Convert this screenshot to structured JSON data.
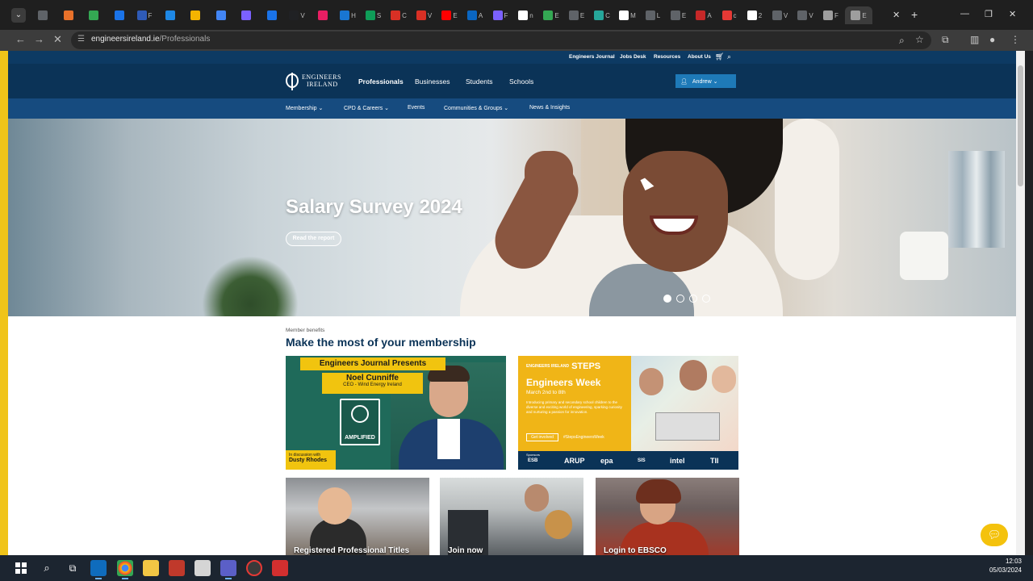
{
  "browser": {
    "url_domain": "engineersireland.ie",
    "url_path": "/Professionals",
    "tabs": [
      {
        "label": "",
        "color": "#5f6368"
      },
      {
        "label": "",
        "color": "#e8712a"
      },
      {
        "label": "",
        "color": "#34a853"
      },
      {
        "label": "",
        "color": "#1a73e8"
      },
      {
        "label": "F",
        "color": "#2f5bb7"
      },
      {
        "label": "",
        "color": "#1e88e5"
      },
      {
        "label": "",
        "color": "#f4b400"
      },
      {
        "label": "",
        "color": "#4285f4"
      },
      {
        "label": "",
        "color": "#7b61ff"
      },
      {
        "label": "",
        "color": "#1a73e8"
      },
      {
        "label": "V",
        "color": "#202124"
      },
      {
        "label": "",
        "color": "#e91e63"
      },
      {
        "label": "H",
        "color": "#1976d2"
      },
      {
        "label": "S",
        "color": "#0f9d58"
      },
      {
        "label": "C",
        "color": "#d93025"
      },
      {
        "label": "V",
        "color": "#d93025"
      },
      {
        "label": "E",
        "color": "#ff0000"
      },
      {
        "label": "A",
        "color": "#0a66c2"
      },
      {
        "label": "F",
        "color": "#7b61ff"
      },
      {
        "label": "n",
        "color": "#ffffff"
      },
      {
        "label": "E",
        "color": "#34a853"
      },
      {
        "label": "E",
        "color": "#5f6368"
      },
      {
        "label": "C",
        "color": "#26a69a"
      },
      {
        "label": "M",
        "color": "#ffffff"
      },
      {
        "label": "L",
        "color": "#5f6368"
      },
      {
        "label": "E",
        "color": "#5f6368"
      },
      {
        "label": "A",
        "color": "#c62828"
      },
      {
        "label": "c",
        "color": "#e53935"
      },
      {
        "label": "2",
        "color": "#ffffff"
      },
      {
        "label": "V",
        "color": "#5f6368"
      },
      {
        "label": "V",
        "color": "#5f6368"
      },
      {
        "label": "F",
        "color": "#9e9e9e"
      },
      {
        "label": "E",
        "color": "#9e9e9e"
      }
    ]
  },
  "site": {
    "utility_links": [
      "Engineers Journal",
      "Jobs Desk",
      "Resources",
      "About Us"
    ],
    "logo_line1": "ENGINEERS",
    "logo_line2": "IRELAND",
    "main_nav": [
      "Professionals",
      "Businesses",
      "Students",
      "Schools"
    ],
    "account_label": "Andrew ⌄",
    "sub_nav": [
      "Membership ⌄",
      "CPD & Careers ⌄",
      "Events",
      "Communities & Groups ⌄",
      "News & Insights"
    ]
  },
  "hero": {
    "title": "Salary Survey 2024",
    "cta": "Read the report",
    "slides": 4,
    "active_slide": 1
  },
  "benefits": {
    "eyebrow": "Member benefits",
    "title": "Make the most of your membership",
    "journal_card": {
      "header": "Engineers Journal Presents",
      "name": "Noel Cunniffe",
      "role": "CEO - Wind Energy Ireland",
      "badge": "AMPLIFIED",
      "discussion": "In discussion with",
      "host": "Dusty Rhodes"
    },
    "steps_card": {
      "logo": "ENGINEERS IRELAND",
      "brand": "STEPS",
      "title": "Engineers Week",
      "dates": "March 2nd to 8th",
      "body": "Introducing primary and secondary school children to the diverse and exciting world of engineering, sparking curiosity and nurturing a passion for innovation.",
      "cta": "Get involved",
      "hashtag": "#StepsEngineersWeek",
      "sponsors_label": "Sponsors",
      "sponsors": [
        "ESB",
        "ARUP",
        "epa",
        "SIS",
        "intel",
        "TII"
      ]
    },
    "photo_cards": [
      "Registered Professional Titles",
      "Join now",
      "Login to EBSCO"
    ]
  },
  "taskbar": {
    "time": "12:03",
    "date": "05/03/2024"
  }
}
